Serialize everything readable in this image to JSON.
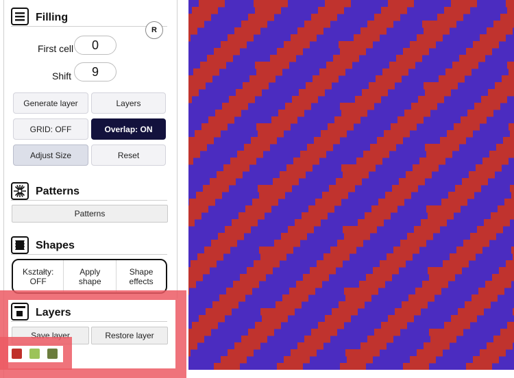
{
  "filling": {
    "title": "Filling",
    "reset_label": "R",
    "first_cell_label": "First cell",
    "first_cell_value": "0",
    "shift_label": "Shift",
    "shift_value": "9",
    "buttons": {
      "generate_layer": "Generate layer",
      "layers": "Layers",
      "grid": "GRID: OFF",
      "overlap": "Overlap: ON",
      "adjust_size": "Adjust Size",
      "reset": "Reset"
    }
  },
  "patterns": {
    "title": "Patterns",
    "button": "Patterns"
  },
  "shapes": {
    "title": "Shapes",
    "ksztalty": "Kształty: OFF",
    "apply_shape": "Apply shape",
    "shape_effects": "Shape effects"
  },
  "layers": {
    "title": "Layers",
    "save_layer": "Save layer",
    "restore_layer": "Restore layer",
    "swatches": [
      "#c0302a",
      "#9cc35a",
      "#6b7d3d"
    ]
  },
  "canvas": {
    "background": "#4b2cc0",
    "stripe_color": "#c0332e"
  }
}
